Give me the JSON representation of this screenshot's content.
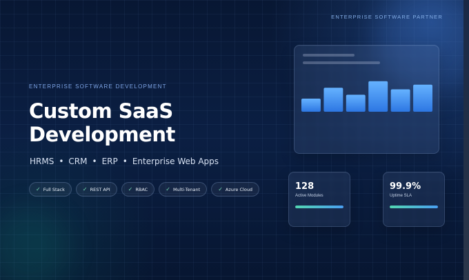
{
  "header": {
    "partner_label": "ENTERPRISE SOFTWARE PARTNER"
  },
  "hero": {
    "kicker": "ENTERPRISE SOFTWARE DEVELOPMENT",
    "title_lines": [
      "Custom SaaS",
      "Development"
    ],
    "services": [
      "HRMS",
      "CRM",
      "ERP",
      "Enterprise Web Apps"
    ],
    "separator": "•"
  },
  "chips": [
    {
      "icon": "check-icon",
      "label": "Full Stack"
    },
    {
      "icon": "check-icon",
      "label": "REST API"
    },
    {
      "icon": "check-icon",
      "label": "RBAC"
    },
    {
      "icon": "check-icon",
      "label": "Multi-Tenant"
    },
    {
      "icon": "check-icon",
      "label": "Azure Cloud"
    }
  ],
  "check_glyph": "✓",
  "dashboard": {
    "chart_data": {
      "type": "bar",
      "categories": [
        "",
        "",
        "",
        "",
        "",
        ""
      ],
      "values": [
        34,
        62,
        44,
        79,
        58,
        70
      ],
      "ylim": [
        0,
        100
      ],
      "grid": false,
      "legend": "none"
    }
  },
  "stats": [
    {
      "value": "128",
      "label": "Active Modules",
      "progress": 1
    },
    {
      "value": "99.9%",
      "label": "Uptime SLA",
      "progress": 1
    }
  ],
  "colors": {
    "background": "#081733",
    "accent": "#4a9ff2",
    "success": "#53d7b2",
    "text_primary": "#ffffff",
    "text_secondary": "#7fa6e8"
  }
}
